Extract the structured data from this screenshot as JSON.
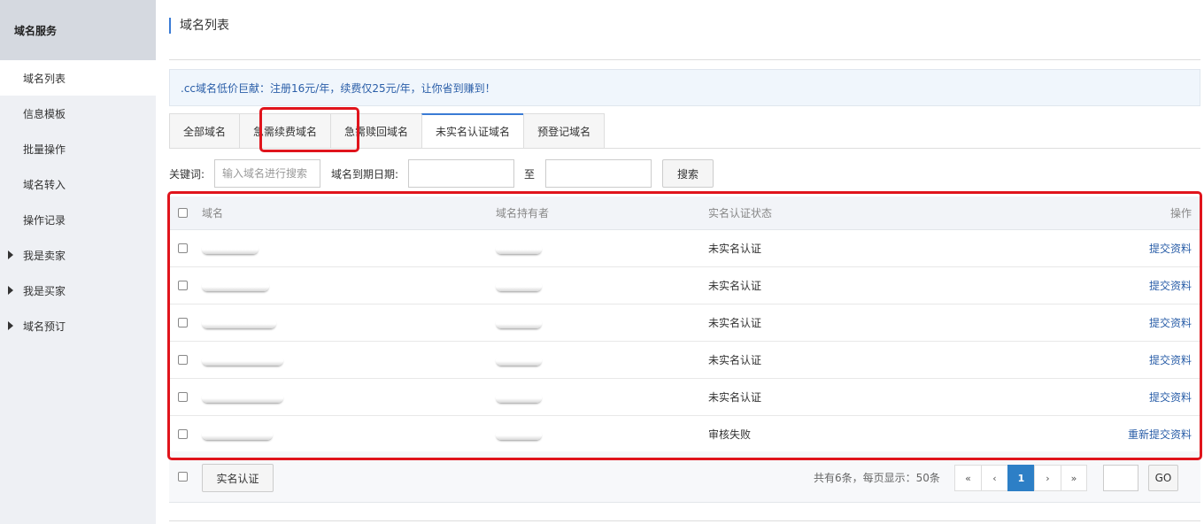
{
  "sidebar": {
    "title": "域名服务",
    "items": [
      {
        "label": "域名列表",
        "active": true,
        "expandable": false
      },
      {
        "label": "信息模板",
        "active": false,
        "expandable": false
      },
      {
        "label": "批量操作",
        "active": false,
        "expandable": false
      },
      {
        "label": "域名转入",
        "active": false,
        "expandable": false
      },
      {
        "label": "操作记录",
        "active": false,
        "expandable": false
      },
      {
        "label": "我是卖家",
        "active": false,
        "expandable": true
      },
      {
        "label": "我是买家",
        "active": false,
        "expandable": true
      },
      {
        "label": "域名预订",
        "active": false,
        "expandable": true
      }
    ]
  },
  "page": {
    "title": "域名列表",
    "notice": ".cc域名低价巨献：注册16元/年，续费仅25元/年，让你省到赚到！"
  },
  "tabs": [
    {
      "label": "全部域名",
      "active": false
    },
    {
      "label": "急需续费域名",
      "active": false
    },
    {
      "label": "急需赎回域名",
      "active": false
    },
    {
      "label": "未实名认证域名",
      "active": true
    },
    {
      "label": "预登记域名",
      "active": false
    }
  ],
  "filter": {
    "keyword_label": "关键词:",
    "keyword_placeholder": "输入域名进行搜索",
    "keyword_value": "",
    "date_label": "域名到期日期:",
    "date_from": "",
    "to_label": "至",
    "date_to": "",
    "search_label": "搜索"
  },
  "table": {
    "headers": {
      "domain": "域名",
      "owner": "域名持有者",
      "status": "实名认证状态",
      "action": "操作"
    },
    "rows": [
      {
        "status": "未实名认证",
        "action": "提交资料"
      },
      {
        "status": "未实名认证",
        "action": "提交资料"
      },
      {
        "status": "未实名认证",
        "action": "提交资料"
      },
      {
        "status": "未实名认证",
        "action": "提交资料"
      },
      {
        "status": "未实名认证",
        "action": "提交资料"
      },
      {
        "status": "审核失败",
        "action": "重新提交资料"
      }
    ]
  },
  "footer": {
    "verify_button": "实名认证",
    "summary": "共有6条，每页显示：50条",
    "pager": {
      "first": "«",
      "prev": "‹",
      "current": "1",
      "next": "›",
      "last": "»"
    },
    "jump_value": "",
    "go_label": "GO"
  },
  "colors": {
    "accent": "#2d7fc6",
    "link": "#2a5ea8",
    "highlight": "#e0141c"
  }
}
